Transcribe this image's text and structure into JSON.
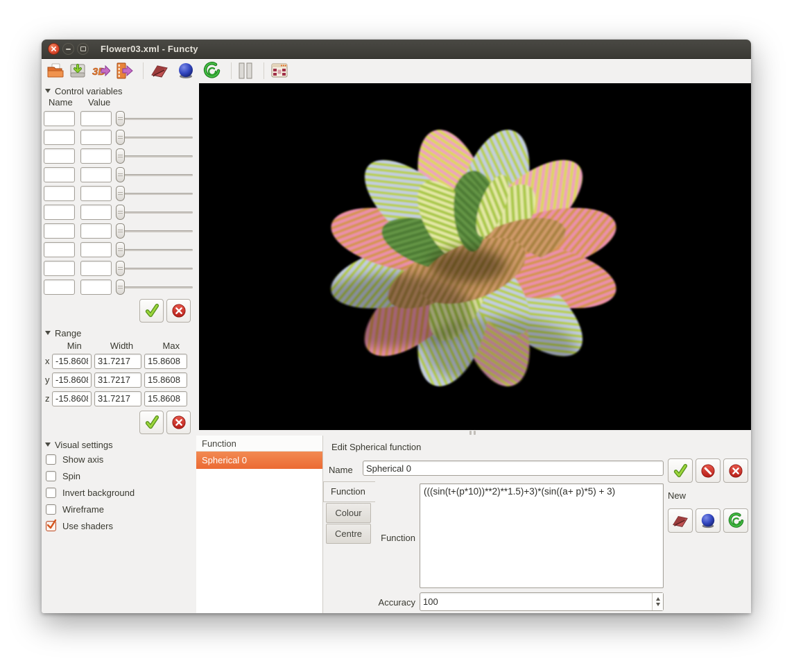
{
  "window": {
    "title": "Flower03.xml - Functy"
  },
  "toolbar": {
    "buttons": [
      "open-file",
      "save-file",
      "export-3d-model",
      "export-video",
      "new-cartesian-function",
      "new-spherical-function",
      "new-curve-function",
      "pause-animation",
      "screen-options"
    ]
  },
  "control_variables": {
    "title": "Control variables",
    "columns": {
      "name": "Name",
      "value": "Value"
    },
    "row_count": 10,
    "rows": [
      {
        "name": "",
        "value": "",
        "slider": 0
      },
      {
        "name": "",
        "value": "",
        "slider": 0
      },
      {
        "name": "",
        "value": "",
        "slider": 0
      },
      {
        "name": "",
        "value": "",
        "slider": 0
      },
      {
        "name": "",
        "value": "",
        "slider": 0
      },
      {
        "name": "",
        "value": "",
        "slider": 0
      },
      {
        "name": "",
        "value": "",
        "slider": 0
      },
      {
        "name": "",
        "value": "",
        "slider": 0
      },
      {
        "name": "",
        "value": "",
        "slider": 0
      },
      {
        "name": "",
        "value": "",
        "slider": 0
      }
    ]
  },
  "range": {
    "title": "Range",
    "columns": [
      "Min",
      "Width",
      "Max"
    ],
    "rows": [
      {
        "axis": "x",
        "min": "-15.8608",
        "width": "31.7217",
        "max": "15.8608"
      },
      {
        "axis": "y",
        "min": "-15.8608",
        "width": "31.7217",
        "max": "15.8608"
      },
      {
        "axis": "z",
        "min": "-15.8608",
        "width": "31.7217",
        "max": "15.8608"
      }
    ]
  },
  "visual_settings": {
    "title": "Visual settings",
    "options": [
      {
        "label": "Show axis",
        "checked": false
      },
      {
        "label": "Spin",
        "checked": false
      },
      {
        "label": "Invert background",
        "checked": false
      },
      {
        "label": "Wireframe",
        "checked": false
      },
      {
        "label": "Use shaders",
        "checked": true
      }
    ]
  },
  "function_list": {
    "header": "Function",
    "items": [
      {
        "label": "Spherical 0",
        "selected": true
      }
    ]
  },
  "editor": {
    "title": "Edit Spherical function",
    "name_label": "Name",
    "name_value": "Spherical 0",
    "tabs": [
      {
        "label": "Function",
        "active": true
      },
      {
        "label": "Colour",
        "active": false
      },
      {
        "label": "Centre",
        "active": false
      }
    ],
    "function_label": "Function",
    "function_value": "(((sin(t+(p*10))**2)**1.5)+3)*(sin((a+ p)*5) + 3)",
    "accuracy_label": "Accuracy",
    "accuracy_value": "100",
    "new_label": "New"
  },
  "colors": {
    "accent_orange": "#f07746",
    "titlebar": "#3c3b37",
    "panel_bg": "#f2f1f0",
    "viewport_bg": "#000000",
    "flower_palette": [
      "#b9cf4e",
      "#c3cde6",
      "#ddd75c",
      "#ef9fc0",
      "#d6944f",
      "#ec8fae",
      "#4e7c34",
      "#a8823f"
    ]
  }
}
